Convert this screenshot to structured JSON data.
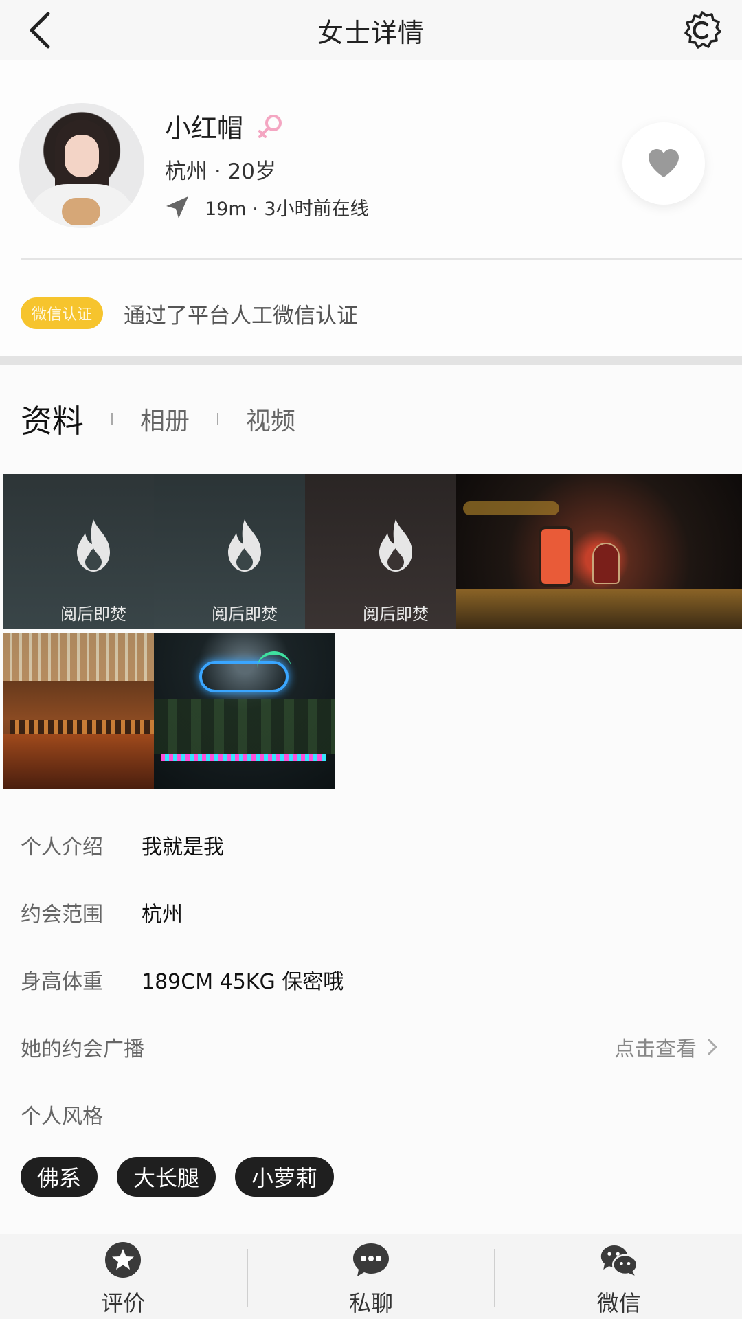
{
  "header": {
    "title": "女士详情",
    "back_icon": "chevron-left-icon",
    "settings_icon": "gear-icon"
  },
  "profile": {
    "name": "小红帽",
    "gender_icon": "female-icon",
    "gender_color": "#f4a6c2",
    "meta": "杭州 · 20岁",
    "location": "19m · 3小时前在线",
    "like_icon": "heart-icon"
  },
  "verify": {
    "badge": "微信认证",
    "text": "通过了平台人工微信认证",
    "badge_color": "#f6c42d"
  },
  "tabs": [
    {
      "label": "资料",
      "active": true
    },
    {
      "label": "相册",
      "active": false
    },
    {
      "label": "视频",
      "active": false
    }
  ],
  "photos": [
    {
      "type": "burn",
      "label": "阅后即焚"
    },
    {
      "type": "burn",
      "label": "阅后即焚"
    },
    {
      "type": "burn",
      "label": "阅后即焚"
    },
    {
      "type": "image",
      "scene": "lantern"
    },
    {
      "type": "image",
      "scene": "bar"
    },
    {
      "type": "image",
      "scene": "neon"
    }
  ],
  "info": {
    "intro_label": "个人介绍",
    "intro_value": "我就是我",
    "range_label": "约会范围",
    "range_value": "杭州",
    "body_label": "身高体重",
    "body_value": "189CM 45KG 保密哦",
    "broadcast_label": "她的约会广播",
    "broadcast_link": "点击查看",
    "style_label": "个人风格"
  },
  "tags": [
    "佛系",
    "大长腿",
    "小萝莉"
  ],
  "bottom_bar": [
    {
      "label": "评价",
      "icon": "star-icon"
    },
    {
      "label": "私聊",
      "icon": "chat-bubble-icon"
    },
    {
      "label": "微信",
      "icon": "wechat-icon"
    }
  ]
}
